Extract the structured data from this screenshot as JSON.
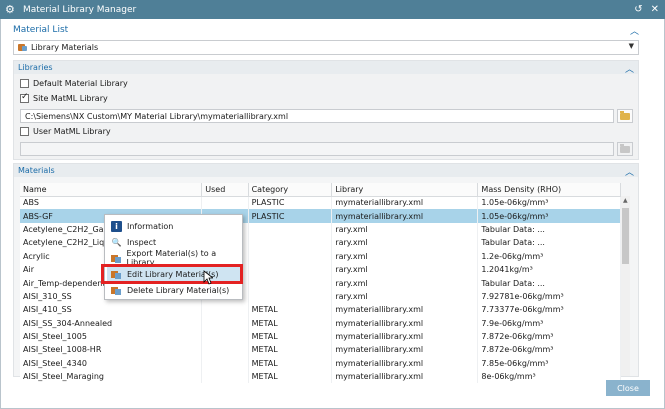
{
  "window": {
    "title": "Material Library Manager"
  },
  "material_list": {
    "heading": "Material List",
    "dropdown_value": "Library Materials"
  },
  "libraries": {
    "heading": "Libraries",
    "default_label": "Default Material Library",
    "default_checked": false,
    "site_label": "Site MatML Library",
    "site_checked": true,
    "site_path": "C:\\Siemens\\NX Custom\\MY Material Library\\mymateriallibrary.xml",
    "user_label": "User MatML Library",
    "user_checked": false,
    "user_path": ""
  },
  "materials": {
    "heading": "Materials",
    "columns": [
      "Name",
      "Used",
      "Category",
      "Library",
      "Mass Density (RHO)"
    ],
    "rows": [
      [
        "ABS",
        "",
        "PLASTIC",
        "mymateriallibrary.xml",
        "1.05e-06kg/mm³"
      ],
      [
        "ABS-GF",
        "",
        "PLASTIC",
        "mymateriallibrary.xml",
        "1.05e-06kg/mm³"
      ],
      [
        "Acetylene_C2H2_Gas",
        "",
        "",
        "rary.xml",
        "Tabular Data: ..."
      ],
      [
        "Acetylene_C2H2_Liquid",
        "",
        "",
        "rary.xml",
        "Tabular Data: ..."
      ],
      [
        "Acrylic",
        "",
        "",
        "rary.xml",
        "1.2e-06kg/mm³"
      ],
      [
        "Air",
        "",
        "",
        "rary.xml",
        "1.2041kg/m³"
      ],
      [
        "Air_Temp-dependent...",
        "",
        "",
        "rary.xml",
        "Tabular Data: ..."
      ],
      [
        "AISI_310_SS",
        "",
        "",
        "rary.xml",
        "7.92781e-06kg/mm³"
      ],
      [
        "AISI_410_SS",
        "",
        "METAL",
        "mymateriallibrary.xml",
        "7.73377e-06kg/mm³"
      ],
      [
        "AISI_SS_304-Annealed",
        "",
        "METAL",
        "mymateriallibrary.xml",
        "7.9e-06kg/mm³"
      ],
      [
        "AISI_Steel_1005",
        "",
        "METAL",
        "mymateriallibrary.xml",
        "7.872e-06kg/mm³"
      ],
      [
        "AISI_Steel_1008-HR",
        "",
        "METAL",
        "mymateriallibrary.xml",
        "7.872e-06kg/mm³"
      ],
      [
        "AISI_Steel_4340",
        "",
        "METAL",
        "mymateriallibrary.xml",
        "7.85e-06kg/mm³"
      ],
      [
        "AISI_Steel_Maraging",
        "",
        "METAL",
        "mymateriallibrary.xml",
        "8e-06kg/mm³"
      ]
    ],
    "selected_row": 1
  },
  "context_menu": {
    "items": [
      {
        "label": "Information",
        "icon": "info-icon"
      },
      {
        "label": "Inspect",
        "icon": "inspect-icon"
      },
      {
        "label": "Export Material(s) to a Library",
        "icon": "export-material-icon"
      },
      {
        "label": "Edit Library Material(s)",
        "icon": "edit-material-icon"
      },
      {
        "label": "Delete Library Material(s)",
        "icon": "delete-material-icon"
      }
    ],
    "highlighted_index": 3
  },
  "footer": {
    "close_label": "Close"
  },
  "colors": {
    "titlebar": "#4f7f97",
    "accent": "#1b6ca8",
    "selection": "#a8d3e9",
    "highlight_box": "#e32222"
  }
}
